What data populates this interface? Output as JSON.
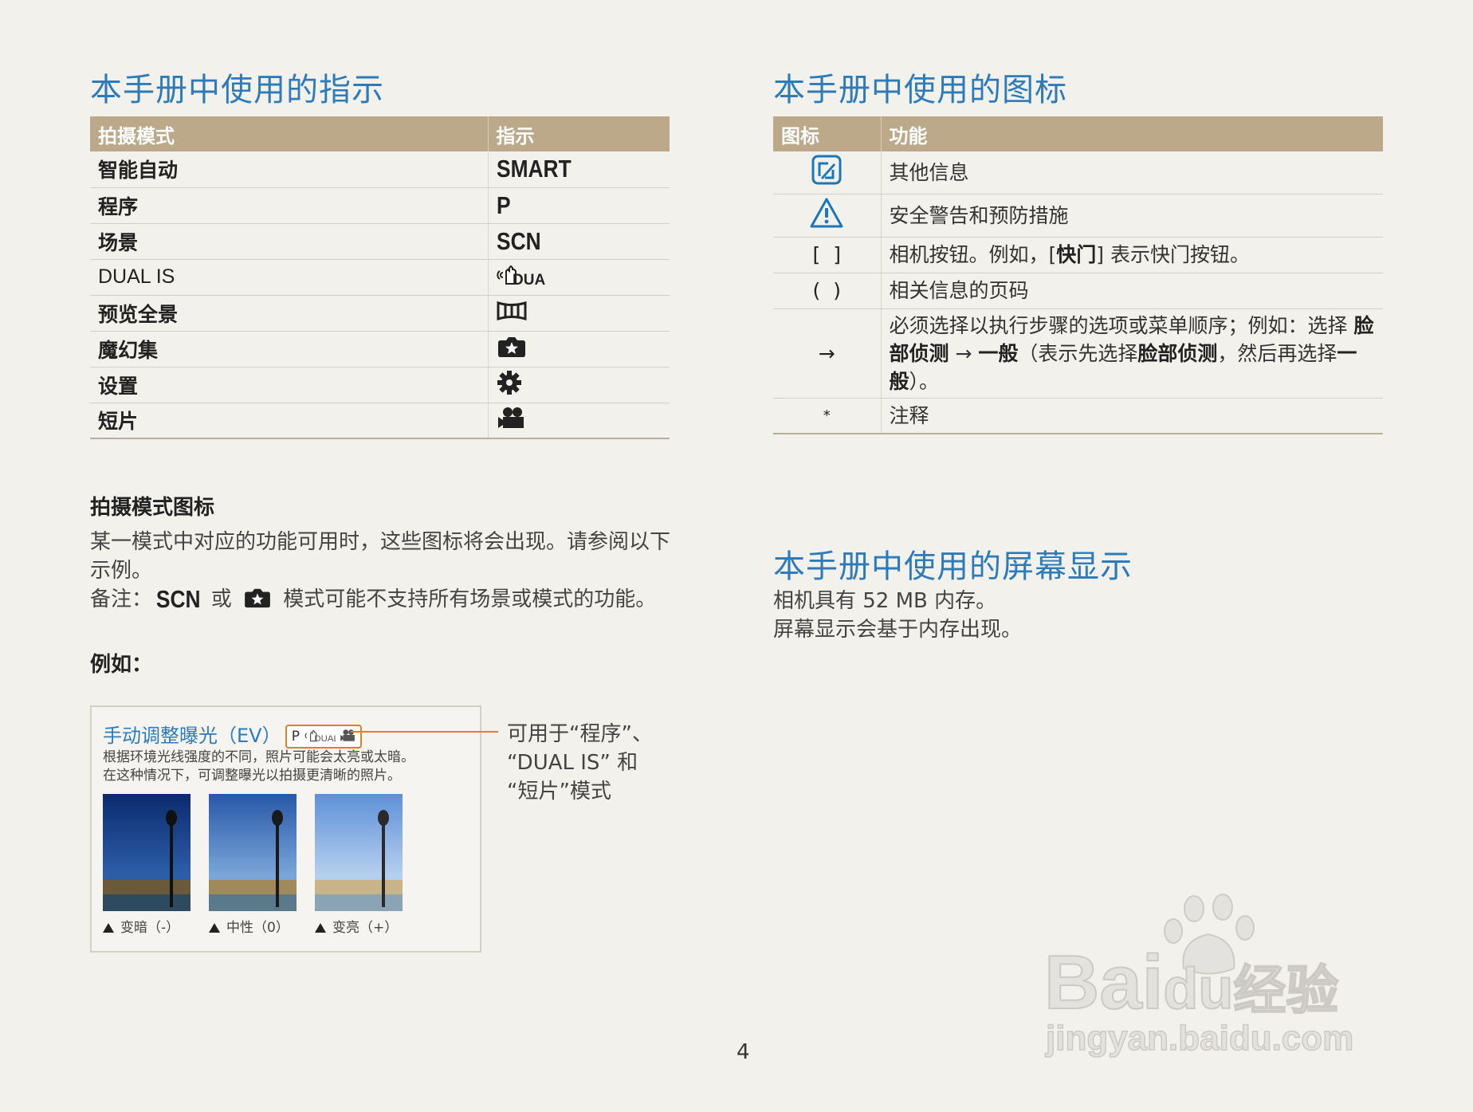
{
  "left": {
    "title": "本手册中使用的指示",
    "table": {
      "headers": [
        "拍摄模式",
        "指示"
      ],
      "rows": [
        {
          "mode": "智能自动",
          "indicator": "SMART",
          "icon": ""
        },
        {
          "mode": "程序",
          "indicator": "P",
          "icon": ""
        },
        {
          "mode": "场景",
          "indicator": "SCN",
          "icon": ""
        },
        {
          "mode": "DUAL IS",
          "indicator": "",
          "icon": "dual-is-icon"
        },
        {
          "mode": "预览全景",
          "indicator": "",
          "icon": "panorama-icon"
        },
        {
          "mode": "魔幻集",
          "indicator": "",
          "icon": "magic-plus-icon"
        },
        {
          "mode": "设置",
          "indicator": "",
          "icon": "gear-icon"
        },
        {
          "mode": "短片",
          "indicator": "",
          "icon": "movie-camera-icon"
        }
      ]
    },
    "mode_icons_heading": "拍摄模式图标",
    "mode_icons_text": "某一模式中对应的功能可用时，这些图标将会出现。请参阅以下示例。",
    "note_prefix": "备注：",
    "note_scn": "SCN",
    "note_or": "或",
    "note_suffix": "模式可能不支持所有场景或模式的功能。",
    "example_label": "例如：",
    "example": {
      "title": "手动调整曝光（EV）",
      "badge_p": "P",
      "desc_line1": "根据环境光线强度的不同，照片可能会太亮或太暗。",
      "desc_line2": "在这种情况下，可调整曝光以拍摄更清晰的照片。",
      "captions": [
        "变暗（-）",
        "中性（0）",
        "变亮（+）"
      ],
      "callout_line1": "可用于“程序”、",
      "callout_line2": "“DUAL IS” 和",
      "callout_line3": "“短片”模式"
    }
  },
  "right": {
    "icons_title": "本手册中使用的图标",
    "icons_table": {
      "headers": [
        "图标",
        "功能"
      ],
      "rows": [
        {
          "symbol": "",
          "icon": "note-icon",
          "func": "其他信息"
        },
        {
          "symbol": "",
          "icon": "warning-icon",
          "func": "安全警告和预防措施"
        },
        {
          "symbol": "[  ]",
          "icon": "",
          "func": "相机按钮。例如，[快门] 表示快门按钮。"
        },
        {
          "symbol": "(  )",
          "icon": "",
          "func": "相关信息的页码"
        },
        {
          "symbol": "→",
          "icon": "",
          "func": "必须选择以执行步骤的选项或菜单顺序；例如：选择 脸部侦测 → 一般（表示先选择脸部侦测，然后再选择一般）。"
        },
        {
          "symbol": "*",
          "icon": "",
          "func": "注释"
        }
      ],
      "row3_parts": [
        "相机按钮。例如，[",
        "快门",
        "] 表示快门按钮。"
      ],
      "row5_parts": [
        "必须选择以执行步骤的选项或菜单顺序；例如：选择",
        "脸部侦测",
        " → ",
        "一般",
        "（表示先选择",
        "脸部侦测",
        "，然后再选择",
        "一般",
        "）。"
      ]
    },
    "screen_title": "本手册中使用的屏幕显示",
    "screen_line1": "相机具有 52 MB 内存。",
    "screen_line2": "屏幕显示会基于内存出现。"
  },
  "page_number": "4",
  "watermark": {
    "brand": "Bai",
    "brand2": "du",
    "cn": "经验",
    "url": "jingyan.baidu.com"
  },
  "colors": {
    "title_blue": "#2e7bb9",
    "header_tan": "#bba98a",
    "callout_orange": "#d9822b",
    "background": "#f3f1ec"
  }
}
